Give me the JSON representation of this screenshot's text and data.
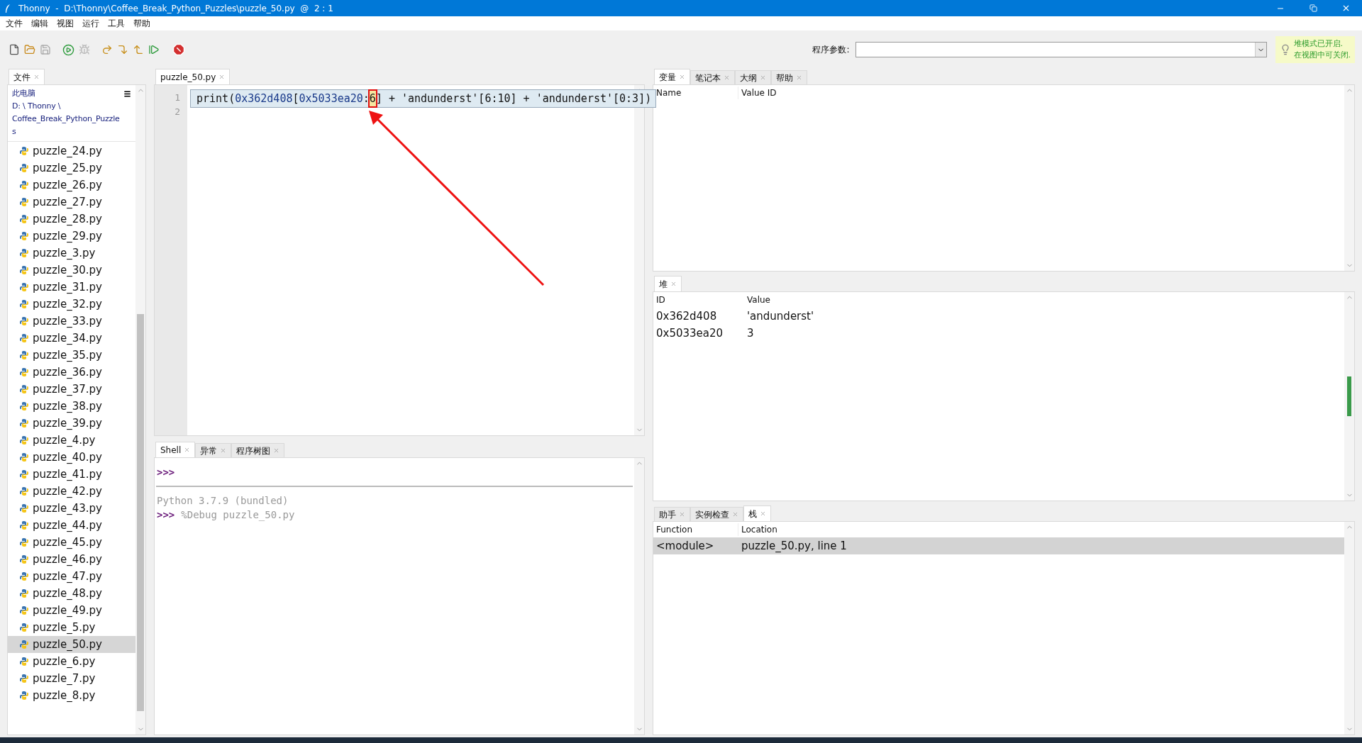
{
  "window": {
    "title": "Thonny  -  D:\\Thonny\\Coffee_Break_Python_Puzzles\\puzzle_50.py  @  2 : 1"
  },
  "menu": [
    "文件",
    "编辑",
    "视图",
    "运行",
    "工具",
    "帮助"
  ],
  "program_args": {
    "label": "程序参数:"
  },
  "tip": {
    "lines": [
      "堆模式已开启.",
      "在视图中可关闭."
    ]
  },
  "files": {
    "tabs": [
      {
        "label": "文件",
        "selected": true
      }
    ],
    "path": [
      "此电脑",
      "D: \\ Thonny \\",
      "Coffee_Break_Python_Puzzle",
      "s"
    ],
    "items": [
      {
        "name": "puzzle_24.py",
        "selected": false
      },
      {
        "name": "puzzle_25.py",
        "selected": false
      },
      {
        "name": "puzzle_26.py",
        "selected": false
      },
      {
        "name": "puzzle_27.py",
        "selected": false
      },
      {
        "name": "puzzle_28.py",
        "selected": false
      },
      {
        "name": "puzzle_29.py",
        "selected": false
      },
      {
        "name": "puzzle_3.py",
        "selected": false
      },
      {
        "name": "puzzle_30.py",
        "selected": false
      },
      {
        "name": "puzzle_31.py",
        "selected": false
      },
      {
        "name": "puzzle_32.py",
        "selected": false
      },
      {
        "name": "puzzle_33.py",
        "selected": false
      },
      {
        "name": "puzzle_34.py",
        "selected": false
      },
      {
        "name": "puzzle_35.py",
        "selected": false
      },
      {
        "name": "puzzle_36.py",
        "selected": false
      },
      {
        "name": "puzzle_37.py",
        "selected": false
      },
      {
        "name": "puzzle_38.py",
        "selected": false
      },
      {
        "name": "puzzle_39.py",
        "selected": false
      },
      {
        "name": "puzzle_4.py",
        "selected": false
      },
      {
        "name": "puzzle_40.py",
        "selected": false
      },
      {
        "name": "puzzle_41.py",
        "selected": false
      },
      {
        "name": "puzzle_42.py",
        "selected": false
      },
      {
        "name": "puzzle_43.py",
        "selected": false
      },
      {
        "name": "puzzle_44.py",
        "selected": false
      },
      {
        "name": "puzzle_45.py",
        "selected": false
      },
      {
        "name": "puzzle_46.py",
        "selected": false
      },
      {
        "name": "puzzle_47.py",
        "selected": false
      },
      {
        "name": "puzzle_48.py",
        "selected": false
      },
      {
        "name": "puzzle_49.py",
        "selected": false
      },
      {
        "name": "puzzle_5.py",
        "selected": false
      },
      {
        "name": "puzzle_50.py",
        "selected": true
      },
      {
        "name": "puzzle_6.py",
        "selected": false
      },
      {
        "name": "puzzle_7.py",
        "selected": false
      },
      {
        "name": "puzzle_8.py",
        "selected": false
      }
    ]
  },
  "editor": {
    "tabs": [
      {
        "label": "puzzle_50.py",
        "selected": true
      }
    ],
    "line_numbers": [
      "1",
      "2"
    ],
    "code": [
      {
        "kind": "plain",
        "text": "print("
      },
      {
        "kind": "number",
        "text": "0x362d408"
      },
      {
        "kind": "plain",
        "text": "["
      },
      {
        "kind": "number",
        "text": "0x5033ea20"
      },
      {
        "kind": "plain",
        "text": ":"
      },
      {
        "kind": "current",
        "text": "6"
      },
      {
        "kind": "plain",
        "text": "] + 'andunderst'[6:10] + 'andunderst'[0:3])"
      }
    ]
  },
  "shell": {
    "tabs": [
      {
        "label": "Shell",
        "selected": true
      },
      {
        "label": "异常",
        "selected": false
      },
      {
        "label": "程序树图",
        "selected": false
      }
    ],
    "lines": [
      {
        "kind": "prompt",
        "prompt": ">>>"
      },
      {
        "kind": "separator"
      },
      {
        "kind": "output",
        "text": "Python 3.7.9 (bundled)"
      },
      {
        "kind": "prompt",
        "prompt": ">>>",
        "text": "%Debug puzzle_50.py"
      }
    ]
  },
  "variables": {
    "tabs": [
      {
        "label": "变量",
        "selected": true
      },
      {
        "label": "笔记本",
        "selected": false
      },
      {
        "label": "大纲",
        "selected": false
      },
      {
        "label": "帮助",
        "selected": false
      }
    ],
    "columns": [
      "Name",
      "Value ID"
    ]
  },
  "heap": {
    "tabs": [
      {
        "label": "堆",
        "selected": true
      }
    ],
    "columns": [
      "ID",
      "Value"
    ],
    "rows": [
      [
        "0x362d408",
        "'andunderst'"
      ],
      [
        "0x5033ea20",
        "3"
      ]
    ]
  },
  "stack": {
    "tabs": [
      {
        "label": "助手",
        "selected": false
      },
      {
        "label": "实例检查",
        "selected": false
      },
      {
        "label": "栈",
        "selected": true
      }
    ],
    "columns": [
      "Function",
      "Location"
    ],
    "rows": [
      {
        "cells": [
          "<module>",
          "puzzle_50.py, line 1"
        ],
        "selected": true
      }
    ]
  }
}
